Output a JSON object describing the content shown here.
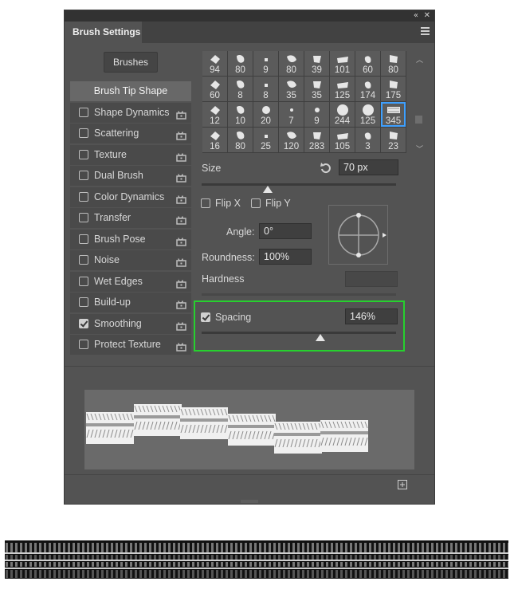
{
  "panel": {
    "tab_label": "Brush Settings",
    "collapse_glyph": "«",
    "close_glyph": "✕",
    "menu_icon": "hamburger-icon"
  },
  "brushes_button": "Brushes",
  "sidebar": {
    "items": [
      {
        "label": "Brush Tip Shape",
        "selected": true
      },
      {
        "label": "Shape Dynamics",
        "checked": false
      },
      {
        "label": "Scattering",
        "checked": false
      },
      {
        "label": "Texture",
        "checked": false
      },
      {
        "label": "Dual Brush",
        "checked": false
      },
      {
        "label": "Color Dynamics",
        "checked": false
      },
      {
        "label": "Transfer",
        "checked": false
      },
      {
        "label": "Brush Pose",
        "checked": false
      },
      {
        "label": "Noise",
        "checked": false
      },
      {
        "label": "Wet Edges",
        "checked": false
      },
      {
        "label": "Build-up",
        "checked": false
      },
      {
        "label": "Smoothing",
        "checked": true
      },
      {
        "label": "Protect Texture",
        "checked": false
      }
    ],
    "lock_icon": "lock-icon"
  },
  "brush_grid": {
    "sizes": [
      "94",
      "80",
      "9",
      "80",
      "39",
      "101",
      "60",
      "80",
      "60",
      "8",
      "8",
      "35",
      "35",
      "125",
      "174",
      "175",
      "12",
      "10",
      "20",
      "7",
      "9",
      "244",
      "125",
      "345",
      "16",
      "80",
      "25",
      "120",
      "283",
      "105",
      "3",
      "23"
    ],
    "selected_index": 23
  },
  "size": {
    "label": "Size",
    "value": "70 px",
    "reset_icon": "reset-icon"
  },
  "flip_x": {
    "label": "Flip X",
    "checked": false
  },
  "flip_y": {
    "label": "Flip Y",
    "checked": false
  },
  "angle": {
    "label": "Angle:",
    "value": "0°"
  },
  "roundness": {
    "label": "Roundness:",
    "value": "100%"
  },
  "hardness": {
    "label": "Hardness",
    "value": ""
  },
  "spacing": {
    "label": "Spacing",
    "value": "146%",
    "checked": true
  },
  "colors": {
    "panel": "#535353",
    "highlight": "#26d12e",
    "selection": "#3ea0ff"
  }
}
